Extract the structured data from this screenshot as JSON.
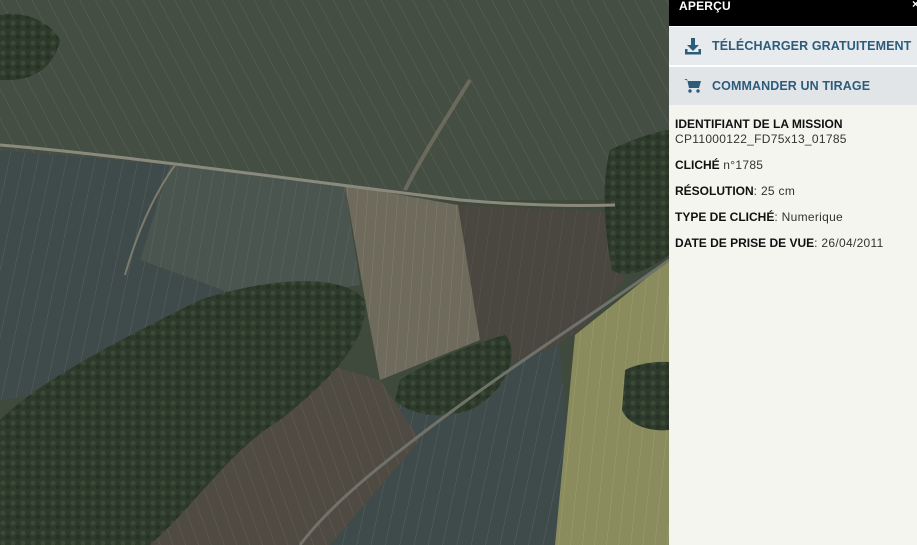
{
  "panel": {
    "title": "APERÇU",
    "close_glyph": "×",
    "actions": {
      "download": {
        "label": "TÉLÉCHARGER GRATUITEMENT",
        "icon": "download-icon"
      },
      "order": {
        "label": "COMMANDER UN TIRAGE",
        "icon": "cart-icon"
      }
    },
    "info": {
      "mission_label": "IDENTIFIANT DE LA MISSION",
      "mission_value": "CP11000122_FD75x13_01785",
      "cliche_label": "CLICHÉ",
      "cliche_value": " n°1785",
      "resolution_label": "RÉSOLUTION",
      "resolution_value": ": 25 cm",
      "type_label": "TYPE DE CLICHÉ",
      "type_value": ": Numerique",
      "date_label": "DATE DE PRISE DE VUE",
      "date_value": ": 26/04/2011"
    }
  },
  "colors": {
    "header_bg": "#000000",
    "action_text": "#2c5c7c",
    "panel_bg": "#f5f5f0"
  }
}
